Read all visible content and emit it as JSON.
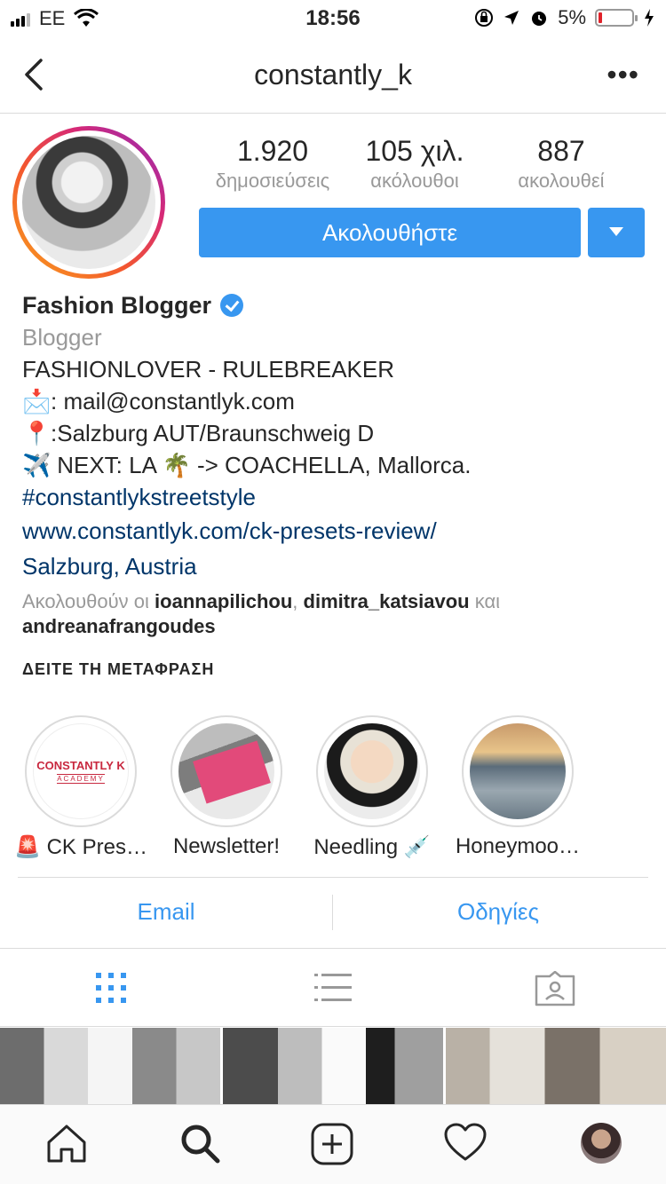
{
  "status_bar": {
    "carrier": "EE",
    "time": "18:56",
    "battery": "5%"
  },
  "nav": {
    "username": "constantly_k",
    "more": "•••"
  },
  "stats": [
    {
      "value": "1.920",
      "label": "δημοσιεύσεις"
    },
    {
      "value": "105 χιλ.",
      "label": "ακόλουθοι"
    },
    {
      "value": "887",
      "label": "ακολουθεί"
    }
  ],
  "follow_button": "Ακολουθήστε",
  "bio": {
    "name": "Fashion Blogger",
    "category": "Blogger",
    "line1": "FASHIONLOVER - RULEBREAKER",
    "line2_emoji": "📩",
    "line2": ": mail@constantlyk.com",
    "line3_emoji": "📍",
    "line3": ":Salzburg AUT/Braunschweig D",
    "line4_emoji": "✈️",
    "line4a": " NEXT: LA ",
    "line4_emoji2": "🌴",
    "line4b": " -> COACHELLA, Mallorca.",
    "hashtag": "#constantlykstreetstyle",
    "website": "www.constantlyk.com/ck-presets-review/",
    "location": "Salzburg, Austria"
  },
  "followed_by": {
    "prefix": "Ακολουθούν οι",
    "user1": "ioannapilichou",
    "sep": ",",
    "user2": "dimitra_katsiavou",
    "and": "και",
    "user3": "andreanafrangoudes"
  },
  "see_translation": "ΔΕΙΤΕ ΤΗ ΜΕΤΑΦΡΑΣΗ",
  "highlights": [
    {
      "label": "🚨 CK Pres…",
      "logo": "CONSTANTLY K",
      "logo_sub": "ACADEMY"
    },
    {
      "label": "Newsletter!"
    },
    {
      "label": "Needling 💉"
    },
    {
      "label": "Honeymoo…"
    }
  ],
  "contact": {
    "email": "Email",
    "directions": "Οδηγίες"
  },
  "accent_color": "#3897f0"
}
